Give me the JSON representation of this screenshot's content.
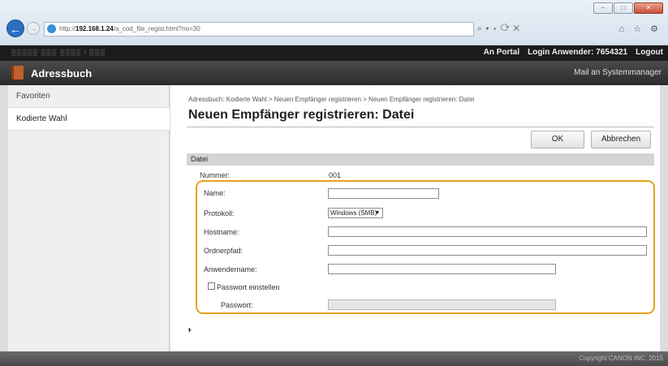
{
  "browser": {
    "url_prefix": "http://",
    "url_host": "192.168.1.24",
    "url_path": "/a_cod_file_regist.html?no=30",
    "nav_controls": "⌕ ▾ ⋆ ⟳ ✕",
    "nav_icons": "⌂ ☆ ⚙",
    "win_min": "–",
    "win_max": "□",
    "win_close": "✕"
  },
  "header": {
    "device_name": "▒▒▒▒▒  ▒▒▒ ▒▒▒▒ / ▒▒▒",
    "portal_link": "An Portal",
    "login_label": "Login Anwender:",
    "login_user": "7654321",
    "logout_link": "Logout",
    "app_title": "Adressbuch",
    "mail_link": "Mail an Systemmanager"
  },
  "sidebar": {
    "items": [
      {
        "label": "Favoriten"
      },
      {
        "label": "Kodierte Wahl"
      }
    ]
  },
  "main": {
    "breadcrumb": "Adressbuch: Kodierte Wahl > Neuen Empfänger registrieren > Neuen Empfänger registrieren: Datei",
    "heading": "Neuen Empfänger registrieren: Datei",
    "ok_label": "OK",
    "cancel_label": "Abbrechen",
    "section_title": "Datei",
    "number_label": "Nummer:",
    "number_value": "001",
    "name_label": "Name:",
    "name_value": "",
    "protocol_label": "Protokoll:",
    "protocol_value": "Windows (SMB)",
    "hostname_label": "Hostname:",
    "hostname_value": "",
    "folder_label": "Ordnerpfad:",
    "folder_value": "",
    "username_label": "Anwendername:",
    "username_value": "",
    "password_checkbox_label": "Passwort einstellen",
    "password_checked": false,
    "password_label": "Passwort:",
    "to_top_icon": "ⱶ"
  },
  "footer": {
    "copyright": "Copyright CANON INC. 2015"
  },
  "colors": {
    "highlight": "#eaa21a",
    "accent": "#2b6fbf"
  }
}
